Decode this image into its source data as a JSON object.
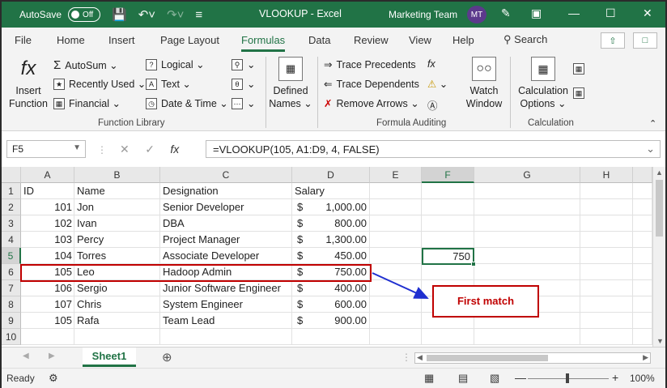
{
  "titlebar": {
    "autosave_label": "AutoSave",
    "autosave_state": "Off",
    "title": "VLOOKUP  -  Excel",
    "team": "Marketing Team",
    "avatar": "MT"
  },
  "menu": {
    "tabs": [
      "File",
      "Home",
      "Insert",
      "Page Layout",
      "Formulas",
      "Data",
      "Review",
      "View",
      "Help"
    ],
    "active": "Formulas",
    "search": "Search"
  },
  "ribbon": {
    "insert_function": [
      "Insert",
      "Function"
    ],
    "autosum": "AutoSum",
    "recently_used": "Recently Used",
    "financial": "Financial",
    "logical": "Logical",
    "text": "Text",
    "date_time": "Date & Time",
    "defined_names": [
      "Defined",
      "Names"
    ],
    "trace_precedents": "Trace Precedents",
    "trace_dependents": "Trace Dependents",
    "remove_arrows": "Remove Arrows",
    "watch_window": [
      "Watch",
      "Window"
    ],
    "calc_options": [
      "Calculation",
      "Options"
    ],
    "groups": [
      "Function Library",
      "Formula Auditing",
      "Calculation"
    ]
  },
  "formula_bar": {
    "name_box": "F5",
    "formula": "=VLOOKUP(105, A1:D9, 4, FALSE)"
  },
  "columns": [
    "A",
    "B",
    "C",
    "D",
    "E",
    "F",
    "G",
    "H"
  ],
  "rows": [
    "1",
    "2",
    "3",
    "4",
    "5",
    "6",
    "7",
    "8",
    "9",
    "10"
  ],
  "header_row": {
    "id": "ID",
    "name": "Name",
    "designation": "Designation",
    "salary": "Salary"
  },
  "data": [
    {
      "id": "101",
      "name": "Jon",
      "designation": "Senior Developer",
      "currency": "$",
      "salary": "1,000.00"
    },
    {
      "id": "102",
      "name": "Ivan",
      "designation": "DBA",
      "currency": "$",
      "salary": "800.00"
    },
    {
      "id": "103",
      "name": "Percy",
      "designation": "Project Manager",
      "currency": "$",
      "salary": "1,300.00"
    },
    {
      "id": "104",
      "name": "Torres",
      "designation": "Associate Developer",
      "currency": "$",
      "salary": "450.00"
    },
    {
      "id": "105",
      "name": "Leo",
      "designation": "Hadoop Admin",
      "currency": "$",
      "salary": "750.00"
    },
    {
      "id": "106",
      "name": "Sergio",
      "designation": "Junior Software Engineer",
      "currency": "$",
      "salary": "400.00"
    },
    {
      "id": "107",
      "name": "Chris",
      "designation": "System Engineer",
      "currency": "$",
      "salary": "600.00"
    },
    {
      "id": "105",
      "name": "Rafa",
      "designation": "Team Lead",
      "currency": "$",
      "salary": "900.00"
    }
  ],
  "result_cell": "750",
  "callout": "First match",
  "sheet_tab": "Sheet1",
  "status": {
    "ready": "Ready",
    "zoom": "100%"
  },
  "colors": {
    "excel_green": "#217346",
    "highlight_red": "#c00000",
    "arrow_blue": "#1f2fd0"
  }
}
